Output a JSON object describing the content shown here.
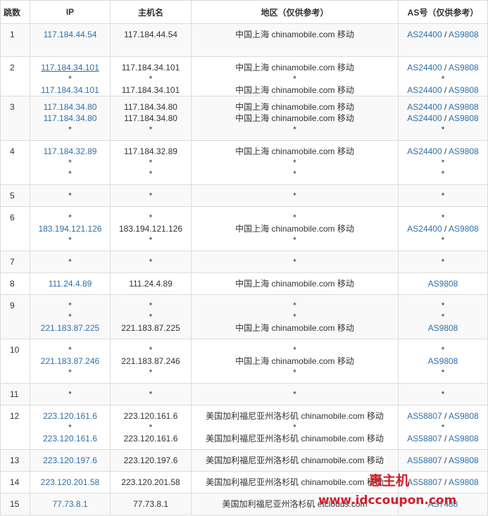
{
  "headers": [
    "跳数",
    "IP",
    "主机名",
    "地区（仅供参考）",
    "AS号（仅供参考）"
  ],
  "rows": [
    {
      "hop": "1",
      "lines": 3,
      "ip": [
        {
          "t": "117.184.44.54",
          "link": true
        }
      ],
      "host": [
        "117.184.44.54"
      ],
      "region": [
        "中国上海 chinamobile.com 移动"
      ],
      "as": [
        [
          "AS24400",
          "AS9808"
        ]
      ]
    },
    {
      "hop": "2",
      "lines": 3,
      "ip": [
        {
          "t": "117.184.34.101",
          "link": true,
          "u": true
        },
        {
          "t": "*"
        },
        {
          "t": "117.184.34.101",
          "link": true
        }
      ],
      "host": [
        "117.184.34.101",
        "*",
        "117.184.34.101"
      ],
      "region": [
        "中国上海 chinamobile.com 移动",
        "*",
        "中国上海 chinamobile.com 移动"
      ],
      "as": [
        [
          "AS24400",
          "AS9808"
        ],
        "*",
        [
          "AS24400",
          "AS9808"
        ]
      ]
    },
    {
      "hop": "3",
      "lines": 4,
      "ip": [
        {
          "t": "117.184.34.80",
          "link": true
        },
        {
          "t": "117.184.34.80",
          "link": true
        },
        {
          "t": "*"
        }
      ],
      "host": [
        "117.184.34.80",
        "117.184.34.80",
        "*"
      ],
      "region": [
        "中国上海 chinamobile.com 移动",
        "中国上海 chinamobile.com 移动",
        "*"
      ],
      "as": [
        [
          "AS24400",
          "AS9808"
        ],
        [
          "AS24400",
          "AS9808"
        ],
        "*"
      ]
    },
    {
      "hop": "4",
      "lines": 4,
      "ip": [
        {
          "t": "117.184.32.89",
          "link": true
        },
        {
          "t": "*"
        },
        {
          "t": "*"
        }
      ],
      "host": [
        "117.184.32.89",
        "*",
        "*"
      ],
      "region": [
        "中国上海 chinamobile.com 移动",
        "*",
        "*"
      ],
      "as": [
        [
          "AS24400",
          "AS9808"
        ],
        "*",
        "*"
      ]
    },
    {
      "hop": "5",
      "lines": 2,
      "ip": [
        {
          "t": "*"
        }
      ],
      "host": [
        "*"
      ],
      "region": [
        "*"
      ],
      "as": [
        "*"
      ]
    },
    {
      "hop": "6",
      "lines": 4,
      "ip": [
        {
          "t": "*"
        },
        {
          "t": "183.194.121.126",
          "link": true
        },
        {
          "t": "*"
        }
      ],
      "host": [
        "*",
        "183.194.121.126",
        "*"
      ],
      "region": [
        "*",
        "中国上海 chinamobile.com 移动",
        "*"
      ],
      "as": [
        "*",
        [
          "AS24400",
          "AS9808"
        ],
        "*"
      ]
    },
    {
      "hop": "7",
      "lines": 2,
      "ip": [
        {
          "t": "*"
        }
      ],
      "host": [
        "*"
      ],
      "region": [
        "*"
      ],
      "as": [
        "*"
      ]
    },
    {
      "hop": "8",
      "lines": 2,
      "ip": [
        {
          "t": "111.24.4.89",
          "link": true
        }
      ],
      "host": [
        "111.24.4.89"
      ],
      "region": [
        "中国上海 chinamobile.com 移动"
      ],
      "as": [
        [
          "AS9808"
        ]
      ]
    },
    {
      "hop": "9",
      "lines": 4,
      "ip": [
        {
          "t": "*"
        },
        {
          "t": "*"
        },
        {
          "t": "221.183.87.225",
          "link": true
        }
      ],
      "host": [
        "*",
        "*",
        "221.183.87.225"
      ],
      "region": [
        "*",
        "*",
        "中国上海 chinamobile.com 移动"
      ],
      "as": [
        "*",
        "*",
        [
          "AS9808"
        ]
      ]
    },
    {
      "hop": "10",
      "lines": 4,
      "ip": [
        {
          "t": "*"
        },
        {
          "t": "221.183.87.246",
          "link": true
        },
        {
          "t": "*"
        }
      ],
      "host": [
        "*",
        "221.183.87.246",
        "*"
      ],
      "region": [
        "*",
        "中国上海 chinamobile.com 移动",
        "*"
      ],
      "as": [
        "*",
        [
          "AS9808"
        ],
        "*"
      ]
    },
    {
      "hop": "11",
      "lines": 2,
      "ip": [
        {
          "t": "*"
        }
      ],
      "host": [
        "*"
      ],
      "region": [
        "*"
      ],
      "as": [
        "*"
      ]
    },
    {
      "hop": "12",
      "lines": 4,
      "ip": [
        {
          "t": "223.120.161.6",
          "link": true
        },
        {
          "t": "*"
        },
        {
          "t": "223.120.161.6",
          "link": true
        }
      ],
      "host": [
        "223.120.161.6",
        "*",
        "223.120.161.6"
      ],
      "region": [
        "美国加利福尼亚州洛杉矶 chinamobile.com 移动",
        "*",
        "美国加利福尼亚州洛杉矶 chinamobile.com 移动"
      ],
      "as": [
        [
          "AS58807",
          "AS9808"
        ],
        "*",
        [
          "AS58807",
          "AS9808"
        ]
      ]
    },
    {
      "hop": "13",
      "lines": 2,
      "ip": [
        {
          "t": "223.120.197.6",
          "link": true
        }
      ],
      "host": [
        "223.120.197.6"
      ],
      "region": [
        "美国加利福尼亚州洛杉矶 chinamobile.com 移动"
      ],
      "as": [
        [
          "AS58807",
          "AS9808"
        ]
      ]
    },
    {
      "hop": "14",
      "lines": 2,
      "ip": [
        {
          "t": "223.120.201.58",
          "link": true
        }
      ],
      "host": [
        "223.120.201.58"
      ],
      "region": [
        "美国加利福尼亚州洛杉矶 chinamobile.com 移动"
      ],
      "as": [
        [
          "AS58807",
          "AS9808"
        ]
      ]
    },
    {
      "hop": "15",
      "lines": 2,
      "ip": [
        {
          "t": "77.73.8.1",
          "link": true
        }
      ],
      "host": [
        "77.73.8.1"
      ],
      "region": [
        "美国加利福尼亚州洛杉矶 etclouds.com"
      ],
      "as": [
        [
          "AS7488"
        ]
      ]
    }
  ],
  "watermark": {
    "top": "惠主机",
    "bottom": "www.idccoupon.com"
  },
  "colors": {
    "link": "#2f6fab",
    "watermark": "#d0202a",
    "border": "#dcdcdc",
    "stripe": "#f9f9f9"
  }
}
